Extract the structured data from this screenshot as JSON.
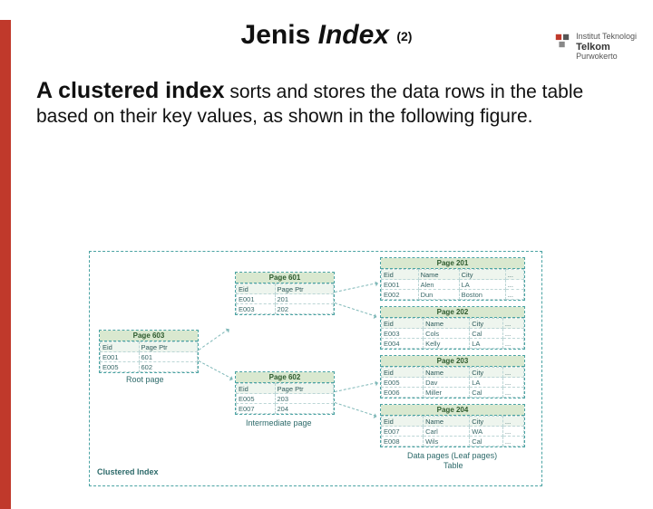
{
  "logo": {
    "line1": "Institut Teknologi",
    "brand": "Telkom",
    "line2": "Purwokerto"
  },
  "title": {
    "word1": "Jenis",
    "word2": "Index",
    "suffix": "(2)"
  },
  "body": {
    "lead": "A clustered index",
    "rest": " sorts and stores the data rows in the table based on their key values, as shown in the following figure."
  },
  "labels": {
    "root": "Root page",
    "intermediate": "Intermediate page",
    "data": "Data pages (Leaf pages)",
    "table": "Table",
    "clustered": "Clustered Index"
  },
  "root_page": {
    "title": "Page 603",
    "cols": [
      "Eid",
      "Page Ptr"
    ],
    "rows": [
      [
        "E001",
        "601"
      ],
      [
        "E005",
        "602"
      ]
    ]
  },
  "inter_pages": [
    {
      "title": "Page 601",
      "cols": [
        "Eid",
        "Page Ptr"
      ],
      "rows": [
        [
          "E001",
          "201"
        ],
        [
          "E003",
          "202"
        ]
      ]
    },
    {
      "title": "Page 602",
      "cols": [
        "Eid",
        "Page Ptr"
      ],
      "rows": [
        [
          "E005",
          "203"
        ],
        [
          "E007",
          "204"
        ]
      ]
    }
  ],
  "data_pages": [
    {
      "title": "Page 201",
      "cols": [
        "Eid",
        "Name",
        "City",
        "..."
      ],
      "rows": [
        [
          "E001",
          "Alen",
          "LA",
          "..."
        ],
        [
          "E002",
          "Dun",
          "Boston",
          "..."
        ]
      ]
    },
    {
      "title": "Page 202",
      "cols": [
        "Eid",
        "Name",
        "City",
        "..."
      ],
      "rows": [
        [
          "E003",
          "Cols",
          "Cal",
          "..."
        ],
        [
          "E004",
          "Kelly",
          "LA",
          "..."
        ]
      ]
    },
    {
      "title": "Page 203",
      "cols": [
        "Eid",
        "Name",
        "City",
        "..."
      ],
      "rows": [
        [
          "E005",
          "Dav",
          "LA",
          "..."
        ],
        [
          "E006",
          "Miller",
          "Cal",
          "..."
        ]
      ]
    },
    {
      "title": "Page 204",
      "cols": [
        "Eid",
        "Name",
        "City",
        "..."
      ],
      "rows": [
        [
          "E007",
          "Carl",
          "WA",
          "..."
        ],
        [
          "E008",
          "Wils",
          "Cal",
          "..."
        ]
      ]
    }
  ]
}
